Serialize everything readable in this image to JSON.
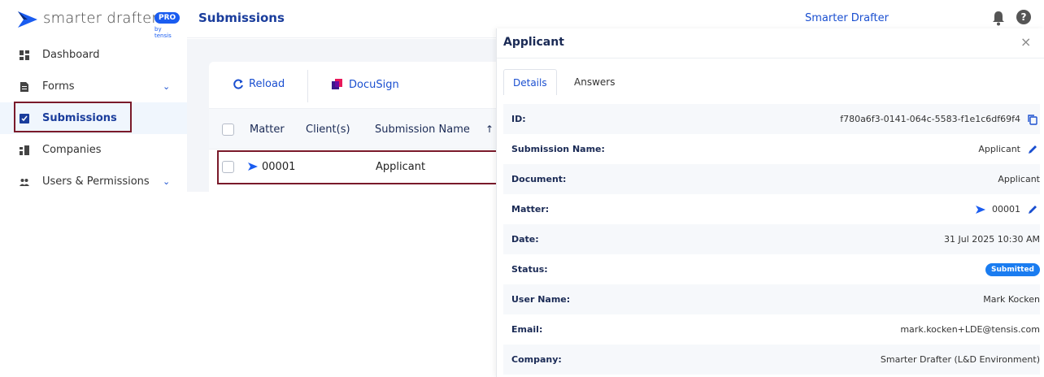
{
  "brand": {
    "name": "smarter drafter",
    "pro": "PRO",
    "by": "by tensis"
  },
  "sidebar": {
    "items": [
      {
        "label": "Dashboard",
        "icon": "dashboard-icon"
      },
      {
        "label": "Forms",
        "icon": "document-icon",
        "expandable": true
      },
      {
        "label": "Submissions",
        "icon": "checkbox-icon",
        "active": true
      },
      {
        "label": "Companies",
        "icon": "building-icon"
      },
      {
        "label": "Users & Permissions",
        "icon": "users-icon",
        "expandable": true
      }
    ]
  },
  "header": {
    "title": "Submissions",
    "brand_link": "Smarter Drafter",
    "help": "?"
  },
  "toolbar": {
    "reload_label": "Reload",
    "docusign_label": "DocuSign"
  },
  "table": {
    "columns": [
      "Matter",
      "Client(s)",
      "Submission Name"
    ],
    "rows": [
      {
        "matter": "00001",
        "clients": "",
        "submission_name": "Applicant"
      }
    ]
  },
  "drawer": {
    "title": "Applicant",
    "close": "×",
    "tabs": [
      "Details",
      "Answers"
    ],
    "fields": [
      {
        "label": "ID:",
        "value": "f780a6f3-0141-064c-5583-f1e1c6df69f4"
      },
      {
        "label": "Submission Name:",
        "value": "Applicant"
      },
      {
        "label": "Document:",
        "value": "Applicant"
      },
      {
        "label": "Matter:",
        "value": "00001"
      },
      {
        "label": "Date:",
        "value": "31 Jul 2025 10:30 AM"
      },
      {
        "label": "Status:",
        "value": "Submitted"
      },
      {
        "label": "User Name:",
        "value": "Mark Kocken"
      },
      {
        "label": "Email:",
        "value": "mark.kocken+LDE@tensis.com"
      },
      {
        "label": "Company:",
        "value": "Smarter Drafter (L&D Environment)"
      }
    ]
  },
  "colors": {
    "accent": "#1a4fd0",
    "title": "#1a3d9c",
    "highlight_outline": "#7a1a2a",
    "badge": "#1a7cf0"
  }
}
